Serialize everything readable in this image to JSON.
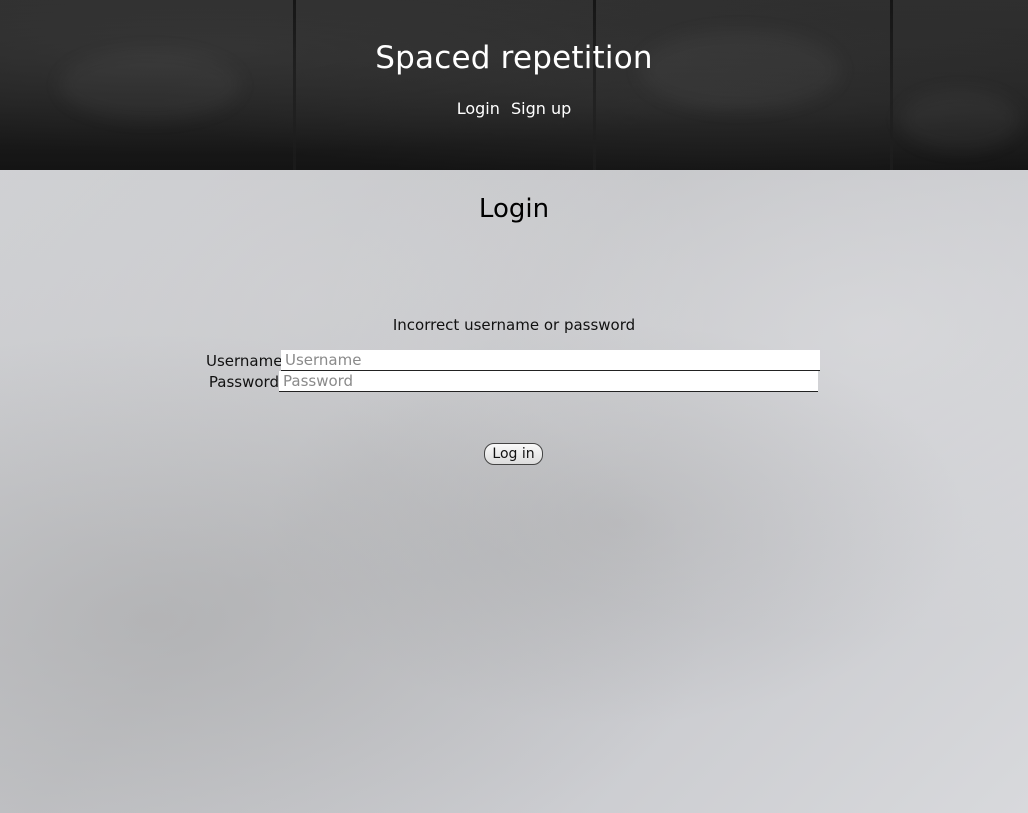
{
  "site": {
    "title": "Spaced repetition"
  },
  "nav": {
    "items": [
      {
        "label": "Login"
      },
      {
        "label": "Sign up"
      }
    ]
  },
  "login_form": {
    "heading": "Login",
    "error_message": "Incorrect username or password",
    "username": {
      "label": "Username",
      "value": "",
      "placeholder": "Username"
    },
    "password": {
      "label": "Password",
      "value": "",
      "placeholder": "Password"
    },
    "submit_label": "Log in"
  },
  "colors": {
    "header_bg": "#1f1f1f",
    "main_bg": "#c4c5c8",
    "text_light": "#ffffff",
    "text_dark": "#111111"
  }
}
